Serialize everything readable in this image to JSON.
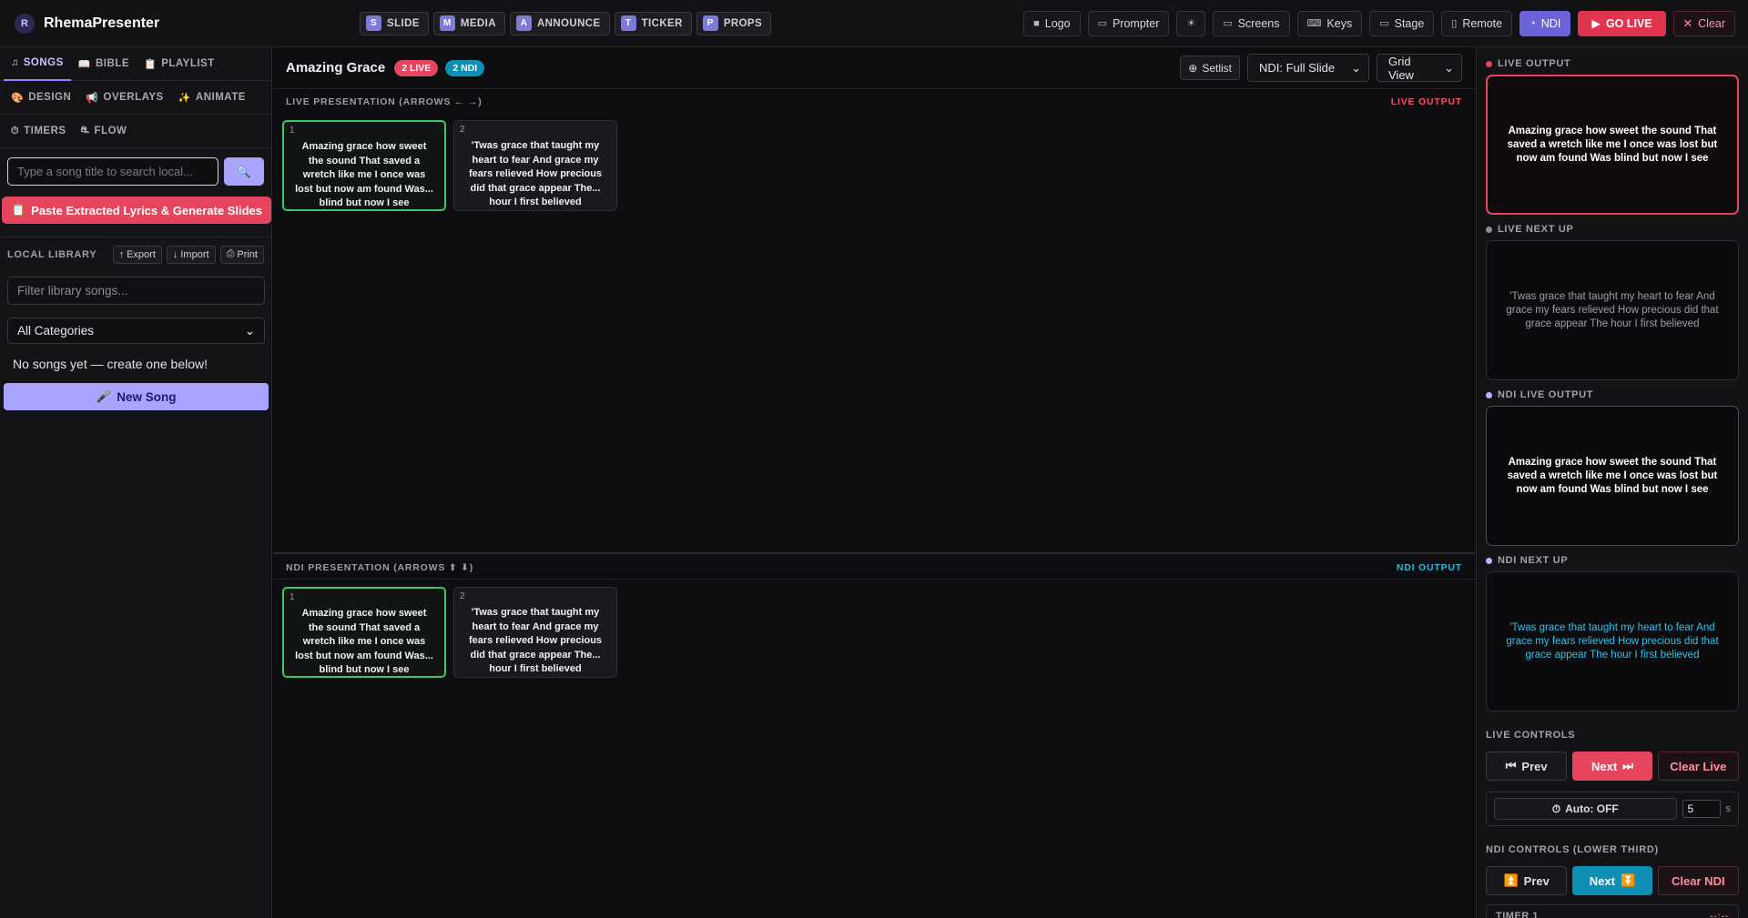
{
  "app": {
    "title": "RhemaPresenter"
  },
  "modes": [
    {
      "key": "S",
      "label": "SLIDE"
    },
    {
      "key": "M",
      "label": "MEDIA"
    },
    {
      "key": "A",
      "label": "ANNOUNCE"
    },
    {
      "key": "T",
      "label": "TICKER"
    },
    {
      "key": "P",
      "label": "PROPS"
    }
  ],
  "toolbar": {
    "logo": "Logo",
    "prompter": "Prompter",
    "theme_icon": "☀",
    "screens": "Screens",
    "keys": "Keys",
    "stage": "Stage",
    "remote": "Remote",
    "ndi": "NDI",
    "go_live": "GO LIVE",
    "clear": "Clear"
  },
  "sidebar": {
    "tabs": [
      {
        "icon": "♫",
        "label": "SONGS"
      },
      {
        "icon": "📖",
        "label": "BIBLE"
      },
      {
        "icon": "📋",
        "label": "PLAYLIST"
      },
      {
        "icon": "🎨",
        "label": "DESIGN"
      },
      {
        "icon": "📢",
        "label": "OVERLAYS"
      },
      {
        "icon": "✨",
        "label": "ANIMATE"
      },
      {
        "icon": "⏱",
        "label": "TIMERS"
      },
      {
        "icon": "⛐",
        "label": "FLOW"
      }
    ],
    "search_placeholder": "Type a song title to search local...",
    "search_icon": "🔍",
    "paste_button": "Paste Extracted Lyrics & Generate Slides",
    "paste_icon": "📋",
    "library_title": "LOCAL LIBRARY",
    "export": "Export",
    "import": "Import",
    "print": "Print",
    "filter_placeholder": "Filter library songs...",
    "category": "All Categories",
    "empty": "No songs yet — create one below!",
    "new_song": "New Song",
    "new_song_icon": "🎤"
  },
  "main": {
    "song_title": "Amazing Grace",
    "live_badge": "2 LIVE",
    "ndi_badge": "2 NDI",
    "setlist": "Setlist",
    "ndi_mode": "NDI: Full Slide",
    "view": "Grid View",
    "live_section": "LIVE PRESENTATION (ARROWS ← →)",
    "live_output": "LIVE OUTPUT",
    "ndi_section": "NDI PRESENTATION (ARROWS ⬆ ⬇)",
    "ndi_output": "NDI OUTPUT",
    "live_slides": [
      {
        "num": "1",
        "text": "Amazing grace how sweet the sound That saved a wretch like me I once was lost but now am found Was... blind but now I see",
        "active": true
      },
      {
        "num": "2",
        "text": "'Twas grace that taught my heart to fear And grace my fears relieved How precious did that grace appear The... hour I first believed",
        "active": false
      }
    ],
    "ndi_slides": [
      {
        "num": "1",
        "text": "Amazing grace how sweet the sound That saved a wretch like me I once was lost but now am found Was... blind but now I see",
        "active": true
      },
      {
        "num": "2",
        "text": "'Twas grace that taught my heart to fear And grace my fears relieved How precious did that grace appear The... hour I first believed",
        "active": false
      }
    ]
  },
  "rpanel": {
    "live_output_label": "LIVE OUTPUT",
    "live_output_text": "Amazing grace how sweet the sound That saved a wretch like me I once was lost but now am found Was blind but now I see",
    "live_next_label": "LIVE NEXT UP",
    "live_next_text": "'Twas grace that taught my heart to fear And grace my fears relieved How precious did that grace appear The hour I first believed",
    "ndi_live_label": "NDI LIVE OUTPUT",
    "ndi_live_text": "Amazing grace how sweet the sound That saved a wretch like me I once was lost but now am found Was blind but now I see",
    "ndi_next_label": "NDI NEXT UP",
    "ndi_next_text": "'Twas grace that taught my heart to fear And grace my fears relieved How precious did that grace appear The hour I first believed",
    "live_controls": "LIVE CONTROLS",
    "prev": "Prev",
    "next": "Next",
    "clear_live": "Clear Live",
    "auto": "Auto: OFF",
    "auto_value": "5",
    "auto_unit": "s",
    "ndi_controls": "NDI CONTROLS (LOWER THIRD)",
    "clear_ndi": "Clear NDI",
    "timer_label": "TIMER 1",
    "timer_value": "--:--"
  },
  "colors": {
    "accent": "#8b86ff",
    "live": "#e5465d",
    "ndi": "#0e8fb3",
    "active_slide": "#3ac968"
  }
}
